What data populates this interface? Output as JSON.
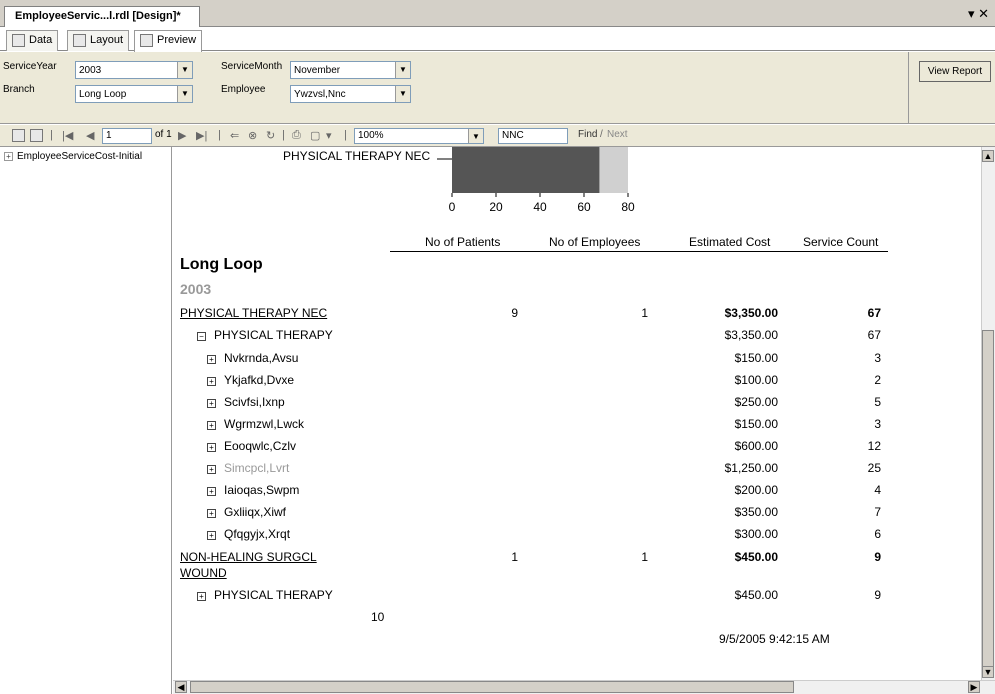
{
  "window": {
    "doc_tab": "EmployeeServic...l.rdl [Design]*",
    "controls": "▾ ✕"
  },
  "view_tabs": [
    {
      "label": "Data"
    },
    {
      "label": "Layout"
    },
    {
      "label": "Preview"
    }
  ],
  "params": {
    "service_year_label": "ServiceYear",
    "service_year_value": "2003",
    "service_month_label": "ServiceMonth",
    "service_month_value": "November",
    "branch_label": "Branch",
    "branch_value": "Long Loop",
    "employee_label": "Employee",
    "employee_value": "Ywzvsl,Nnc",
    "view_report": "View Report"
  },
  "toolbar": {
    "page_value": "1",
    "of_pages": "of 1",
    "zoom": "100%",
    "find_text": "NNC",
    "find_label": "Find",
    "next_label": "Next",
    "sep": "|"
  },
  "docmap": {
    "item": "EmployeeServiceCost-Initial"
  },
  "report": {
    "chart_label": "PHYSICAL THERAPY NEC",
    "chart_ticks": [
      "0",
      "20",
      "40",
      "60",
      "80"
    ],
    "headers": {
      "patients": "No of Patients",
      "employees": "No of Employees",
      "cost": "Estimated Cost",
      "count": "Service Count"
    },
    "branch": "Long Loop",
    "year": "2003",
    "group1": {
      "name": "PHYSICAL THERAPY NEC",
      "patients": "9",
      "employees": "1",
      "cost": "$3,350.00",
      "count": "67"
    },
    "sub1": {
      "name": "PHYSICAL THERAPY",
      "cost": "$3,350.00",
      "count": "67"
    },
    "employees": [
      {
        "name": "Nvkrnda,Avsu",
        "cost": "$150.00",
        "count": "3"
      },
      {
        "name": "Ykjafkd,Dvxe",
        "cost": "$100.00",
        "count": "2"
      },
      {
        "name": "Scivfsi,Ixnp",
        "cost": "$250.00",
        "count": "5"
      },
      {
        "name": "Wgrmzwl,Lwck",
        "cost": "$150.00",
        "count": "3"
      },
      {
        "name": "Eooqwlc,Czlv",
        "cost": "$600.00",
        "count": "12"
      },
      {
        "name": "Simcpcl,Lvrt",
        "cost": "$1,250.00",
        "count": "25"
      },
      {
        "name": "Iaioqas,Swpm",
        "cost": "$200.00",
        "count": "4"
      },
      {
        "name": "Gxliiqx,Xiwf",
        "cost": "$350.00",
        "count": "7"
      },
      {
        "name": "Qfqgyjx,Xrqt",
        "cost": "$300.00",
        "count": "6"
      }
    ],
    "group2": {
      "name_line1": "NON-HEALING SURGCL",
      "name_line2": "WOUND",
      "patients": "1",
      "employees": "1",
      "cost": "$450.00",
      "count": "9"
    },
    "sub2": {
      "name": "PHYSICAL THERAPY",
      "cost": "$450.00",
      "count": "9"
    },
    "total_patients": "10",
    "timestamp": "9/5/2005 9:42:15 AM"
  },
  "chart_data": {
    "type": "bar",
    "categories": [
      "PHYSICAL THERAPY NEC"
    ],
    "values": [
      67
    ],
    "xlim": [
      0,
      80
    ],
    "ticks": [
      0,
      20,
      40,
      60,
      80
    ]
  }
}
